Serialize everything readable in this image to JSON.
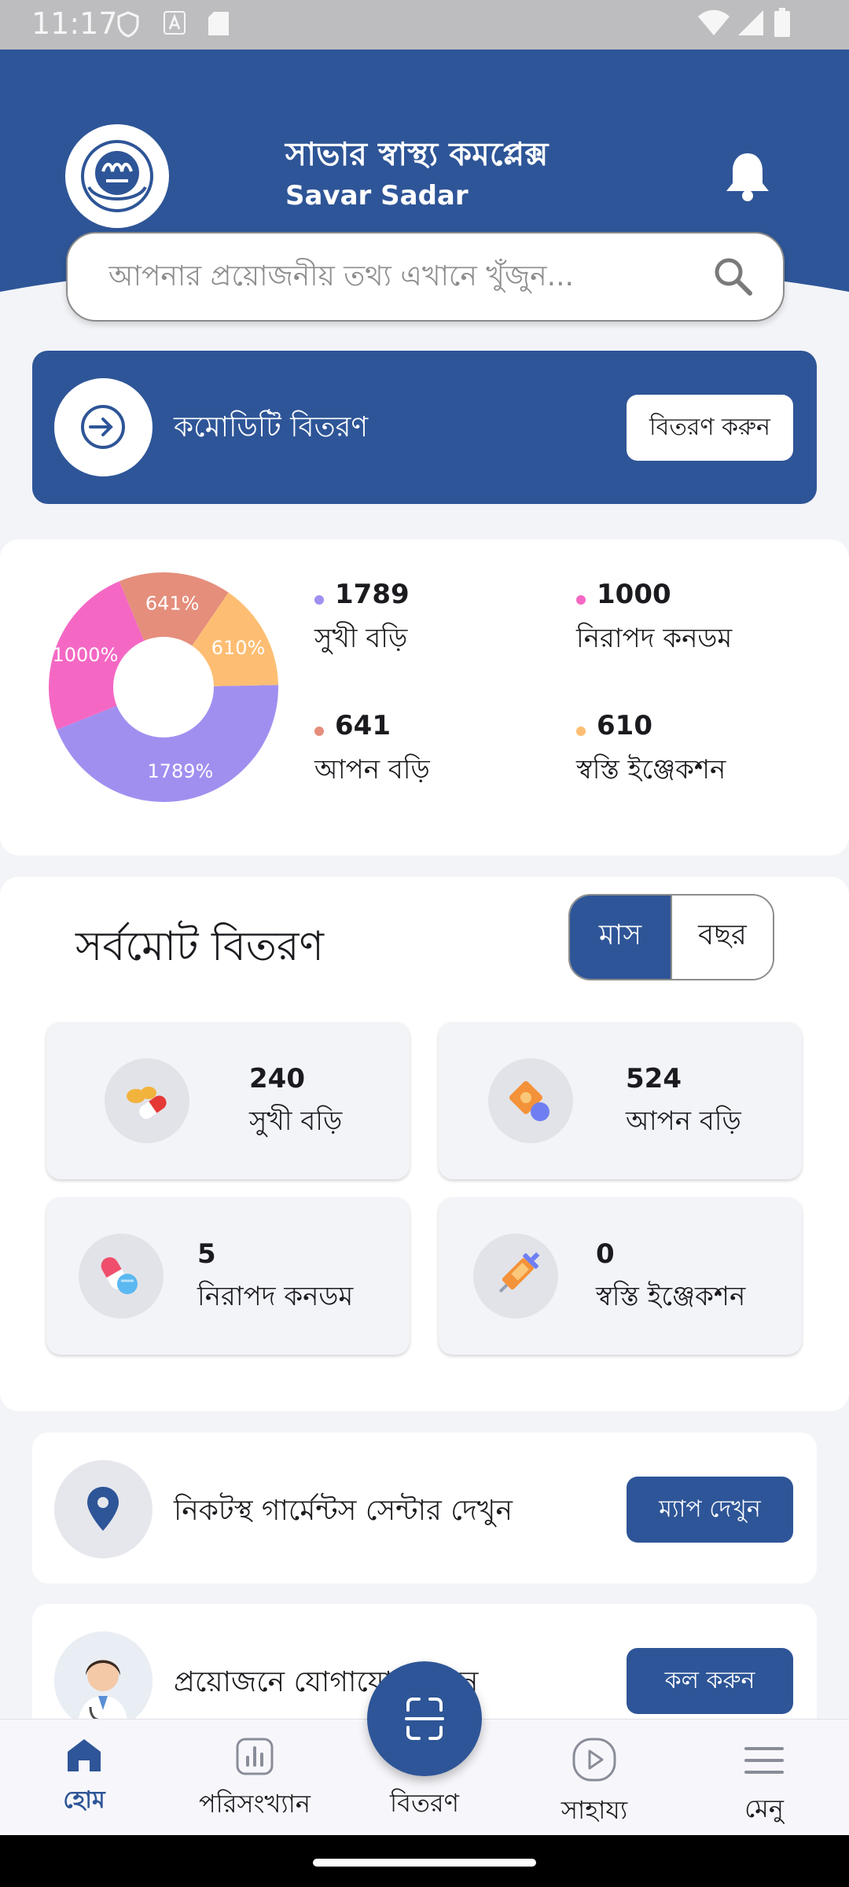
{
  "status_bar": {
    "time": "11:17"
  },
  "header": {
    "title": "সাভার স্বাস্থ্য কমপ্লেক্স",
    "subtitle": "Savar Sadar"
  },
  "search": {
    "placeholder": "আপনার প্রয়োজনীয় তথ্য এখানে খুঁজুন..."
  },
  "distribution": {
    "label": "কমোডিটি বিতরণ",
    "button": "বিতরণ করুন"
  },
  "chart_data": {
    "type": "pie",
    "categories": [
      "সুখী বড়ি",
      "নিরাপদ কনডম",
      "আপন বড়ি",
      "স্বস্তি ইঞ্জেকশন"
    ],
    "values": [
      1789,
      1000,
      641,
      610
    ],
    "slice_labels": [
      "1789%",
      "1000%",
      "641%",
      "610%"
    ],
    "colors": [
      "#a18ff0",
      "#f468c4",
      "#e58e7c",
      "#fdbe73"
    ]
  },
  "legend": [
    {
      "value": "1789",
      "name": "সুখী বড়ি",
      "color": "#a18ff0"
    },
    {
      "value": "1000",
      "name": "নিরাপদ কনডম",
      "color": "#f468c4"
    },
    {
      "value": "641",
      "name": "আপন বড়ি",
      "color": "#e58e7c"
    },
    {
      "value": "610",
      "name": "স্বস্তি ইঞ্জেকশন",
      "color": "#fdbe73"
    }
  ],
  "totals": {
    "title": "সর্বমোট বিতরণ",
    "toggle": {
      "month": "মাস",
      "year": "বছর",
      "selected": "মাস"
    },
    "cards": [
      {
        "value": "240",
        "label": "সুখী বড়ি",
        "icon": "pills-icon"
      },
      {
        "value": "524",
        "label": "আপন বড়ি",
        "icon": "contraceptive-pack-icon"
      },
      {
        "value": "5",
        "label": "নিরাপদ কনডম",
        "icon": "capsule-icon"
      },
      {
        "value": "0",
        "label": "স্বস্তি ইঞ্জেকশন",
        "icon": "syringe-icon"
      }
    ]
  },
  "actions": [
    {
      "text": "নিকটস্থ গার্মেন্টস সেন্টার দেখুন",
      "button": "ম্যাপ দেখুন",
      "icon": "location-pin-icon"
    },
    {
      "text": "প্রয়োজনে যোগাযোগ করুন",
      "button": "কল করুন",
      "icon": "doctor-avatar"
    }
  ],
  "bottom_nav": {
    "home": "হোম",
    "stats": "পরিসংখ্যান",
    "distribute": "বিতরণ",
    "help": "সাহায্য",
    "menu": "মেনু",
    "active": "হোম"
  },
  "colors": {
    "primary": "#2e5597",
    "background": "#f3f4f8"
  }
}
